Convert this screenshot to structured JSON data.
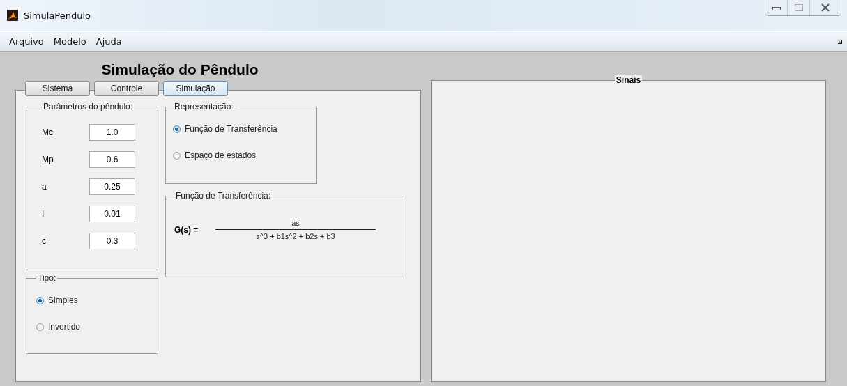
{
  "window": {
    "title": "SimulaPendulo"
  },
  "menu": [
    {
      "label": "Arquivo"
    },
    {
      "label": "Modelo"
    },
    {
      "label": "Ajuda"
    }
  ],
  "heading": "Simulação do Pêndulo",
  "tabs": [
    {
      "label": "Sistema",
      "selected": false
    },
    {
      "label": "Controle",
      "selected": false
    },
    {
      "label": "Simulação",
      "selected": true
    }
  ],
  "parameters": {
    "title": "Parâmetros do pêndulo:",
    "fields": [
      {
        "label": "Mc",
        "value": "1.0"
      },
      {
        "label": "Mp",
        "value": "0.6"
      },
      {
        "label": "a",
        "value": "0.25"
      },
      {
        "label": "I",
        "value": "0.01"
      },
      {
        "label": "c",
        "value": "0.3"
      }
    ]
  },
  "tipo": {
    "title": "Tipo:",
    "options": [
      {
        "label": "Simples",
        "selected": true
      },
      {
        "label": "Invertido",
        "selected": false
      }
    ]
  },
  "representacao": {
    "title": "Representação:",
    "options": [
      {
        "label": "Função de Transferência",
        "selected": true
      },
      {
        "label": "Espaço de estados",
        "selected": false
      }
    ]
  },
  "transfer_function": {
    "title": "Função de Transferência:",
    "lhs": "G(s) =",
    "numerator": "as",
    "denominator": "s^3 + b1s^2 + b2s + b3"
  },
  "signals_panel": {
    "title": "Sinais"
  }
}
